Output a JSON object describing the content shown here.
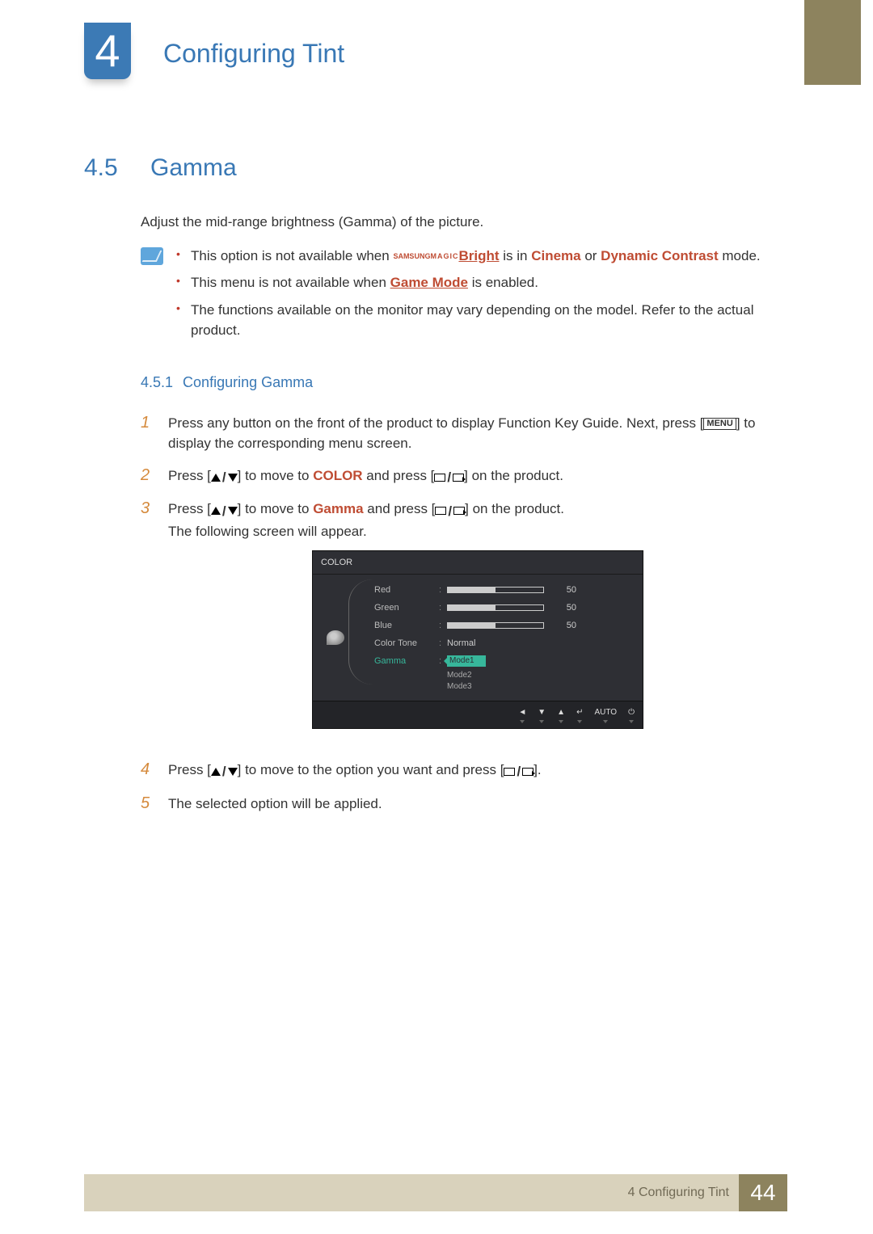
{
  "header": {
    "chapter_number": "4",
    "title": "Configuring Tint"
  },
  "section": {
    "number": "4.5",
    "title": "Gamma",
    "intro": "Adjust the mid-range brightness (Gamma) of the picture."
  },
  "notes": {
    "line1_a": "This option is not available when ",
    "line1_magic_top": "SAMSUNG",
    "line1_magic_bot": "MAGIC",
    "line1_bright": "Bright",
    "line1_b": " is in ",
    "line1_cinema": "Cinema",
    "line1_c": " or ",
    "line1_dc": "Dynamic Contrast",
    "line1_d": " mode.",
    "line2_a": "This menu is not available when ",
    "line2_game": "Game Mode",
    "line2_b": " is enabled.",
    "line3": "The functions available on the monitor may vary depending on the model. Refer to the actual product."
  },
  "subsection": {
    "number": "4.5.1",
    "title": "Configuring Gamma"
  },
  "steps": {
    "s1_a": "Press any button on the front of the product to display Function Key Guide. Next, press [",
    "s1_menu": "MENU",
    "s1_b": "] to display the corresponding menu screen.",
    "s2_a": "Press [",
    "s2_b": "] to move to ",
    "s2_color": "COLOR",
    "s2_c": " and press [",
    "s2_d": "] on the product.",
    "s3_a": "Press [",
    "s3_b": "] to move to ",
    "s3_gamma": "Gamma",
    "s3_c": " and press [",
    "s3_d": "] on the product.",
    "s3_e": "The following screen will appear.",
    "s4_a": "Press [",
    "s4_b": "] to move to the option you want and press [",
    "s4_c": "].",
    "s5": "The selected option will be applied."
  },
  "osd": {
    "title": "COLOR",
    "rows": [
      {
        "label": "Red",
        "value": "50",
        "fill": 50
      },
      {
        "label": "Green",
        "value": "50",
        "fill": 50
      },
      {
        "label": "Blue",
        "value": "50",
        "fill": 50
      }
    ],
    "color_tone_label": "Color Tone",
    "color_tone_value": "Normal",
    "gamma_label": "Gamma",
    "gamma_selected": "Mode1",
    "gamma_options": [
      "Mode2",
      "Mode3"
    ],
    "nav": [
      "◄",
      "▼",
      "▲",
      "↵",
      "AUTO",
      "⏻"
    ]
  },
  "footer": {
    "text": "4 Configuring Tint",
    "page": "44"
  }
}
